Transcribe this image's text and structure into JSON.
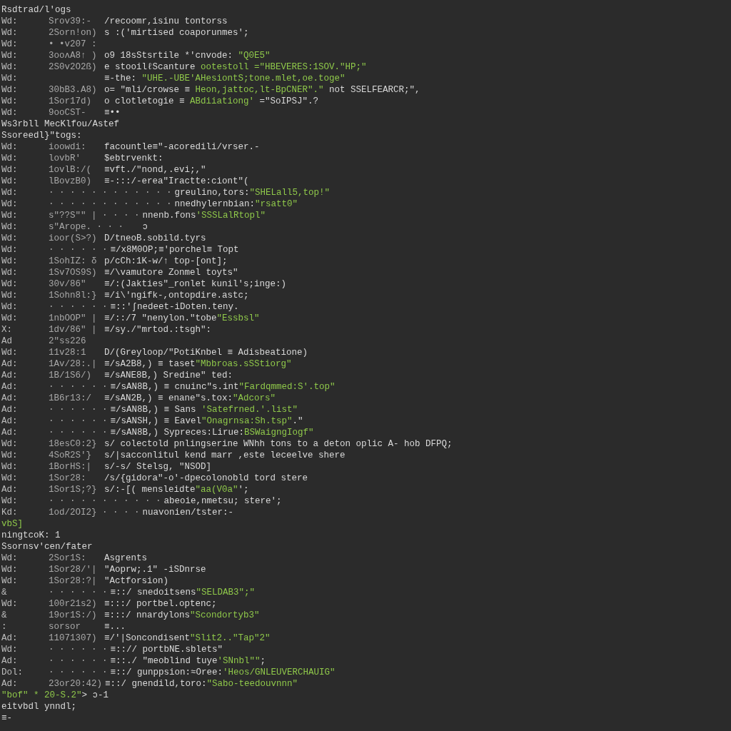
{
  "lines": [
    {
      "kind": "header",
      "code": "Rsdtrad/l'ogs"
    },
    {
      "kind": "entry",
      "prefix": "Wd:",
      "stamp": "Srov39:-",
      "code": "/recoomr,isinu tontorss"
    },
    {
      "kind": "entry",
      "prefix": "Wd:",
      "stamp": "2Sorn!on)",
      "code": "s :('mirtised coaporunmes';"
    },
    {
      "kind": "entry",
      "prefix": "Wd:",
      "stamp": "• •v207 :"
    },
    {
      "kind": "entry",
      "prefix": "Wd:",
      "stamp": "3ooʌA8↑ )",
      "code": "o9 18sStsrtile *'cnvode: ",
      "string": "\"Q0E5\""
    },
    {
      "kind": "entry",
      "prefix": "Wd:",
      "stamp": "2S0v2O2ß)",
      "code": "e stooilℓScanture ",
      "string": "ootestoll =\"HBEVERES:1SOV.\"HP;\""
    },
    {
      "kind": "entry",
      "prefix": "Wd:",
      "code": "≡-the: ",
      "string": "\"UHE.-UBE'AHesiontS;tone.mlet,oe.toge\""
    },
    {
      "kind": "entry",
      "prefix": "Wd:",
      "stamp": "30bB3.A8)",
      "code": "o= \"mli/crowse ≡ ",
      "string": "Heon,jattoc,lt-BpCNER\".\"",
      "tail": " not SSELFEARCR;\","
    },
    {
      "kind": "entry",
      "prefix": "Wd:",
      "stamp": "1Sor17d)",
      "code": "o clotletogie ≡ ",
      "string": "ABdiiationg'",
      "tail": " =\"SoIPSJ\".?"
    },
    {
      "kind": "entry",
      "prefix": "Wd:",
      "stamp": "9ooCST-",
      "code": "≡••"
    },
    {
      "kind": "header",
      "code": "Ws3rbll MecKlfou/Astef"
    },
    {
      "kind": "header",
      "code": "Ssoreedl}\"togs:"
    },
    {
      "kind": "entry",
      "prefix": "Wd:",
      "stamp": "ioowdi:",
      "code": "facountle≡\"-acoredili/vrser.-"
    },
    {
      "kind": "entry",
      "prefix": "Wd:",
      "stamp": "lovbR'",
      "code": "$ebtrvenkt:"
    },
    {
      "kind": "entry",
      "prefix": "Wd:",
      "stamp": "1ovlB:/(",
      "code": "≡vft./\"nond,.evi;,\""
    },
    {
      "kind": "entry",
      "prefix": "Wd:",
      "stamp": "lBovzB0)",
      "code": "≡-:::/-erea\"Iractte:ciont\"("
    },
    {
      "kind": "entry",
      "prefix": "Wd:",
      "stamp": "· · · · · · · · · · · ·",
      "code": "greulino,tors:",
      "string": "\"SHELall5,top!\""
    },
    {
      "kind": "entry",
      "prefix": "Wd:",
      "stamp": "· · · · · · · · · · · ·",
      "code": "nnedhylernbian:",
      "string": "\"rsatt0\""
    },
    {
      "kind": "entry",
      "prefix": "Wd:",
      "stamp": "s\"??S\"\" | · · · ·",
      "code": "nnenb.fons",
      "string": "'SSSLalRtopl\""
    },
    {
      "kind": "entry",
      "prefix": "Wd:",
      "stamp": "s\"Arope. · · ·",
      "code": "   ↄ"
    },
    {
      "kind": "entry",
      "prefix": "Wd:",
      "stamp": "ioor(S>?)",
      "code": "D/tneoB.sobild.tyrs"
    },
    {
      "kind": "entry",
      "prefix": "Wd:",
      "stamp": "· · · · · ·",
      "code": "≡/x8M0OP;≡'porchel≡ Topt"
    },
    {
      "kind": "entry",
      "prefix": "Wd:",
      "stamp": "1SohIZ: δ",
      "code": "p/cCh:1K-w/↑ top-[ont];"
    },
    {
      "kind": "entry",
      "prefix": "Wd:",
      "stamp": "1Sv7OS9S)",
      "code": "≡/\\vamutore Zonmel toyts\""
    },
    {
      "kind": "entry",
      "prefix": "Wd:",
      "stamp": "30v/86\"",
      "code": "≡/:(Jakties\"_ronlet kunil's;inge:)"
    },
    {
      "kind": "entry",
      "prefix": "Wd:",
      "stamp": "1Sohn8l:}",
      "code": "≡/i\\'ngifk-,ontopdire.astc;"
    },
    {
      "kind": "entry",
      "prefix": "Wd:",
      "stamp": "· · · · · ·",
      "code": "≡::'ʃnedeet-iDoten.teny."
    },
    {
      "kind": "entry",
      "prefix": "Wd:",
      "stamp": "1nbOOP\" |",
      "code": "≡/::/7 \"nenylon.\"tobe",
      "string": "\"Essbsl\""
    },
    {
      "kind": "entry",
      "prefix": "X:",
      "stamp": "1dv/86\" |",
      "code": "≡/sy./\"mrtod.:tsgh\":"
    },
    {
      "kind": "entry",
      "prefix": "Ad",
      "stamp": "2\"ss226"
    },
    {
      "kind": "entry",
      "prefix": "Wd:",
      "stamp": "11v28:1",
      "code": "D/(Greyloop/\"PotiKnbel ≡ Adisbeatione)"
    },
    {
      "kind": "entry",
      "prefix": "Ad:",
      "stamp": "1Av/28:.|",
      "code": "≡/sA2B8,) ≡ taset",
      "string": "\"Mbbroas.sSStiorg\""
    },
    {
      "kind": "entry",
      "prefix": "Ad:",
      "stamp": "1B/1S6/)",
      "code": "≡/sANE8B,) Sredine\" ted:"
    },
    {
      "kind": "entry",
      "prefix": "Ad:",
      "stamp": "· · · · · ·",
      "code": "≡/sAN8B,) ≡ cnuinc\"s.int",
      "string": "\"Fardqmmed:S'.top\""
    },
    {
      "kind": "entry",
      "prefix": "Ad:",
      "stamp": "1B6r13:/",
      "code": "≡/sAN2B,) ≡ enane\"s.tox:",
      "string": "\"Adcors\""
    },
    {
      "kind": "entry",
      "prefix": "Ad:",
      "stamp": "· · · · · ·",
      "code": "≡/sAN8B,) ≡ Sans ",
      "string": "'Satefrned.'.list\""
    },
    {
      "kind": "entry",
      "prefix": "Ad:",
      "stamp": "· · · · · ·",
      "code": "≡/sANSH,) ≡ Eavel",
      "string": "\"Onagrnsa:Sh.tsp\"",
      "tail": ".\""
    },
    {
      "kind": "entry",
      "prefix": "Ad:",
      "stamp": "· · · · · ·",
      "code": "≡/sAN8B,) Sypreces:Lirue:",
      "string": "BSWaigngIogf\""
    },
    {
      "kind": "entry",
      "prefix": "Wd:",
      "stamp": "18esC0:2}",
      "code": "s/ colectold pnlingserine WNhh tons to a deton oplic A- hob DFPQ;"
    },
    {
      "kind": "entry",
      "prefix": "Wd:",
      "stamp": "4SoR2S'}",
      "code": "s/|sacconlitul kend marr ,este leceelve shere"
    },
    {
      "kind": "entry",
      "prefix": "Wd:",
      "stamp": "1BorHS:|",
      "code": "s/-s/ Stelsg, \"NSOD]"
    },
    {
      "kind": "entry",
      "prefix": "Wd:",
      "stamp": "1Sor28:",
      "code": "/s/{gidora\"-o'-dpecolonobld tord stere"
    },
    {
      "kind": "entry",
      "prefix": "Ad:",
      "stamp": "1Sor1S;?}",
      "code": "s/:-[( mensleidte",
      "string": "\"aa(V0a\"",
      "tail": "';"
    },
    {
      "kind": "entry",
      "prefix": "Wd:",
      "stamp": "· · · · · · · · · · ·",
      "code": "abeoie,nmetsu; stere';"
    },
    {
      "kind": "entry",
      "prefix": "Kd:",
      "stamp": "1od/2OI2} · · · ·",
      "code": "nuavonien/tster:-"
    },
    {
      "kind": "header",
      "string": "vbS]"
    },
    {
      "kind": "header",
      "code": "ningtcoK: 1"
    },
    {
      "kind": "header",
      "code": "Ssornsv'cen/fater"
    },
    {
      "kind": "entry",
      "prefix": "Wd:",
      "stamp": "2Sor1S:",
      "code": "Asgrents"
    },
    {
      "kind": "entry",
      "prefix": "Wd:",
      "stamp": "1Sor28/'|",
      "code": "\"Aoprw;.1\" -iSDnrse"
    },
    {
      "kind": "entry",
      "prefix": "Wd:",
      "stamp": "1Sor28:?|",
      "code": "\"Actforsion)"
    },
    {
      "kind": "entry",
      "prefix": "&",
      "stamp": "· · · · · ·",
      "code": "≡::/ snedoitsens",
      "string": "\"SELDAB3\";\""
    },
    {
      "kind": "entry",
      "prefix": "Wd:",
      "stamp": "100r21s2)",
      "code": "≡:::/ portbel.optenc;"
    },
    {
      "kind": "entry",
      "prefix": "&",
      "stamp": "19or1S:/)",
      "code": "≡:::/ nnardylons",
      "string": "\"Scondortyb3\""
    },
    {
      "kind": "entry",
      "prefix": ":",
      "stamp": "sorsor",
      "code": "≡..."
    },
    {
      "kind": "entry",
      "prefix": "Ad:",
      "stamp": "11071307)",
      "code": "≡/'|Soncondisent",
      "string": "\"Slit2..\"Tap\"2\""
    },
    {
      "kind": "entry",
      "prefix": "Wd:",
      "stamp": "· · · · · ·",
      "code": "≡::// portbNE.sblets\""
    },
    {
      "kind": "entry",
      "prefix": "Ad:",
      "stamp": "· · · · · ·",
      "code": "≡::./ \"meoblind tuye",
      "string": "'SNnbl\"\"",
      "tail": ";"
    },
    {
      "kind": "entry",
      "prefix": "Dol:",
      "stamp": "· · · · · ·",
      "code": "≡::/ gunppsion:≈Oree:",
      "string": "'Heos/GNLEUVERCHAUIG\""
    },
    {
      "kind": "entry",
      "prefix": "Ad:",
      "stamp": "23or20:42)",
      "code": "≡::/ gnendild,toro:",
      "string": "\"Sabo-teedouvnnn\""
    },
    {
      "kind": "header",
      "string": "\"bof\" * 20-S.2\"",
      "tail": "> ↄ-1"
    },
    {
      "kind": "header",
      "code": "eitvbdl ynndl;"
    },
    {
      "kind": "header",
      "code": "≡-"
    }
  ]
}
